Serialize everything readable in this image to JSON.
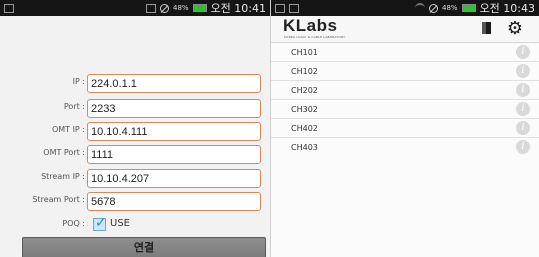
{
  "left": {
    "status": {
      "battery": "48%",
      "time": "오전 10:41"
    },
    "form": [
      {
        "key": "ip",
        "label": "IP :",
        "value": "224.0.1.1"
      },
      {
        "key": "port",
        "label": "Port :",
        "value": "2233"
      },
      {
        "key": "omt_ip",
        "label": "OMT IP :",
        "value": "10.10.4.111"
      },
      {
        "key": "omt_port",
        "label": "OMT Port :",
        "value": "1111"
      },
      {
        "key": "stream_ip",
        "label": "Stream IP :",
        "value": "10.10.4.207"
      },
      {
        "key": "stream_port",
        "label": "Stream Port :",
        "value": "5678"
      }
    ],
    "poq": {
      "label": "POQ :",
      "checkbox_label": "USE",
      "checked": true
    },
    "connect_label": "연결"
  },
  "right": {
    "status": {
      "battery": "48%",
      "time": "오전 10:43"
    },
    "app": {
      "title": "KLabs",
      "subtitle": "KOREA LOGIC & CABLE LABORATORY"
    },
    "channels": [
      "CH101",
      "CH102",
      "CH202",
      "CH302",
      "CH402",
      "CH403"
    ]
  },
  "colors": {
    "input_border": "#d98a5a",
    "checkbox": "#1a8fd8",
    "battery": "#2fbf2f"
  }
}
